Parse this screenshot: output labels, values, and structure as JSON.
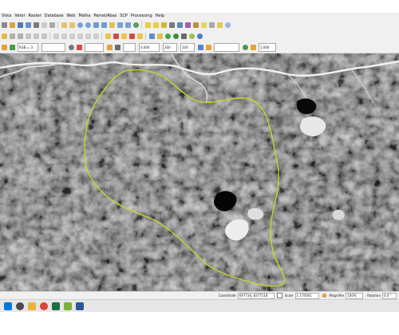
{
  "menu": [
    "Vista",
    "Vetor",
    "Raster",
    "Database",
    "Web",
    "Malha",
    "Painel/Abas",
    "SCP",
    "Processing",
    "Help"
  ],
  "toolbar3": {
    "band_combo": "RGB = 3",
    "field_a": "0.000",
    "field_b": "200",
    "field_c": "100",
    "field_d": "1.000"
  },
  "status": {
    "coordinate_label": "Coordinate",
    "coordinate_value": "697734, 8377118",
    "scale_label": "Scale",
    "scale_value": "1:170001",
    "magnifier_label": "Magnifier",
    "magnifier_value": "100%",
    "rotation_label": "Rotation",
    "rotation_value": "0.0 °"
  },
  "colors": {
    "aoi_boundary": "#c8d62a",
    "map_background": "#1c1c1c",
    "toolbar_bg": "#f0f0f0"
  },
  "icons": {
    "toolbar1": [
      "new-project-icon",
      "open-icon",
      "save-icon",
      "save-as-icon",
      "print-icon",
      "layout-icon",
      "style-icon",
      "pan-icon",
      "pan-selection-icon",
      "zoom-in-icon",
      "zoom-out-icon",
      "zoom-full-icon",
      "zoom-layer-icon",
      "zoom-selection-icon",
      "zoom-last-icon",
      "zoom-next-icon",
      "refresh-icon",
      "identify-icon",
      "select-icon",
      "deselect-icon",
      "attribute-table-icon",
      "field-calc-icon",
      "statistics-icon",
      "measure-icon",
      "annotation-icon",
      "map-tips-icon",
      "text-annotation-icon",
      "help-icon"
    ],
    "toolbar2": [
      "edit-icon",
      "digitize-icon",
      "save-edits-icon",
      "add-feature-icon",
      "move-feature-icon",
      "node-tool-icon",
      "delete-icon",
      "cut-icon",
      "copy-icon",
      "paste-icon",
      "undo-icon",
      "redo-icon",
      "label-icon",
      "label-pin-icon",
      "label-move-icon",
      "label-rotate-icon",
      "label-change-icon",
      "plugin-icon",
      "python-icon",
      "scp-roi-icon",
      "scp-classify-icon",
      "scp-settings-icon",
      "grass-icon",
      "globe-icon"
    ],
    "toolbar3": [
      "scp-home-icon",
      "scp-band-icon",
      "scp-preview-icon",
      "scp-roi-pointer-icon",
      "scp-draw-icon",
      "scp-redo-icon",
      "scp-zoom-icon",
      "scp-filter-icon",
      "scp-search-icon",
      "scp-classification-icon"
    ],
    "taskbar": [
      "windows-start-icon",
      "search-icon",
      "file-explorer-icon",
      "chrome-icon",
      "excel-icon",
      "qgis-icon",
      "word-icon"
    ]
  }
}
